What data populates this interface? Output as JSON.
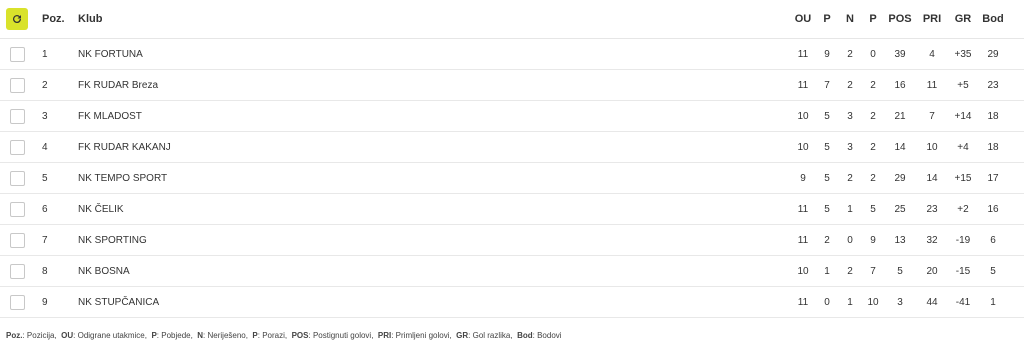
{
  "header": {
    "pos": "Poz.",
    "club": "Klub",
    "ou": "OU",
    "p": "P",
    "n": "N",
    "p2": "P",
    "pos2": "POS",
    "pri": "PRI",
    "gr": "GR",
    "bod": "Bod"
  },
  "rows": [
    {
      "pos": "1",
      "club": "NK FORTUNA",
      "ou": "11",
      "p": "9",
      "n": "2",
      "p2": "0",
      "pos2": "39",
      "pri": "4",
      "gr": "+35",
      "bod": "29"
    },
    {
      "pos": "2",
      "club": "FK RUDAR Breza",
      "ou": "11",
      "p": "7",
      "n": "2",
      "p2": "2",
      "pos2": "16",
      "pri": "11",
      "gr": "+5",
      "bod": "23"
    },
    {
      "pos": "3",
      "club": "FK MLADOST",
      "ou": "10",
      "p": "5",
      "n": "3",
      "p2": "2",
      "pos2": "21",
      "pri": "7",
      "gr": "+14",
      "bod": "18"
    },
    {
      "pos": "4",
      "club": "FK RUDAR KAKANJ",
      "ou": "10",
      "p": "5",
      "n": "3",
      "p2": "2",
      "pos2": "14",
      "pri": "10",
      "gr": "+4",
      "bod": "18"
    },
    {
      "pos": "5",
      "club": "NK TEMPO SPORT",
      "ou": "9",
      "p": "5",
      "n": "2",
      "p2": "2",
      "pos2": "29",
      "pri": "14",
      "gr": "+15",
      "bod": "17"
    },
    {
      "pos": "6",
      "club": "NK ČELIK",
      "ou": "11",
      "p": "5",
      "n": "1",
      "p2": "5",
      "pos2": "25",
      "pri": "23",
      "gr": "+2",
      "bod": "16"
    },
    {
      "pos": "7",
      "club": "NK SPORTING",
      "ou": "11",
      "p": "2",
      "n": "0",
      "p2": "9",
      "pos2": "13",
      "pri": "32",
      "gr": "-19",
      "bod": "6"
    },
    {
      "pos": "8",
      "club": "NK BOSNA",
      "ou": "10",
      "p": "1",
      "n": "2",
      "p2": "7",
      "pos2": "5",
      "pri": "20",
      "gr": "-15",
      "bod": "5"
    },
    {
      "pos": "9",
      "club": "NK STUPČANICA",
      "ou": "11",
      "p": "0",
      "n": "1",
      "p2": "10",
      "pos2": "3",
      "pri": "44",
      "gr": "-41",
      "bod": "1"
    }
  ],
  "legend": [
    {
      "key": "Poz.",
      "desc": "Pozicija"
    },
    {
      "key": "OU",
      "desc": "Odigrane utakmice"
    },
    {
      "key": "P",
      "desc": "Pobjede"
    },
    {
      "key": "N",
      "desc": "Neriješeno"
    },
    {
      "key": "P",
      "desc": "Porazi"
    },
    {
      "key": "POS",
      "desc": "Postignuti golovi"
    },
    {
      "key": "PRI",
      "desc": "Primljeni golovi"
    },
    {
      "key": "GR",
      "desc": "Gol razlika"
    },
    {
      "key": "Bod",
      "desc": "Bodovi"
    }
  ],
  "colors": {
    "accent": "#d9e22b"
  },
  "icons": {
    "refresh": "refresh-icon"
  }
}
